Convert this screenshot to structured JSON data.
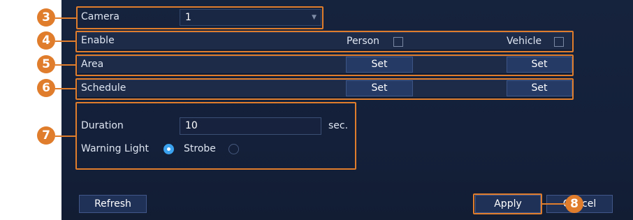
{
  "camera": {
    "label": "Camera",
    "value": "1"
  },
  "enable": {
    "label": "Enable",
    "person_label": "Person",
    "person_checked": false,
    "vehicle_label": "Vehicle",
    "vehicle_checked": false
  },
  "area": {
    "label": "Area",
    "set_label": "Set"
  },
  "schedule": {
    "label": "Schedule",
    "set_label": "Set"
  },
  "duration": {
    "label": "Duration",
    "value": "10",
    "unit": "sec."
  },
  "warning_light": {
    "label": "Warning Light",
    "selected": "Warning Light",
    "option_strobe": "Strobe"
  },
  "footer": {
    "refresh_label": "Refresh",
    "apply_label": "Apply",
    "cancel_label": "Cancel"
  },
  "callouts": [
    "3",
    "4",
    "5",
    "6",
    "7",
    "8"
  ],
  "colors": {
    "panel_bg": "#16233d",
    "accent_orange": "#e07d2c",
    "radio_selected": "#3aa2ee"
  },
  "icons": {
    "select_arrow": "dropdown-arrow-icon"
  }
}
